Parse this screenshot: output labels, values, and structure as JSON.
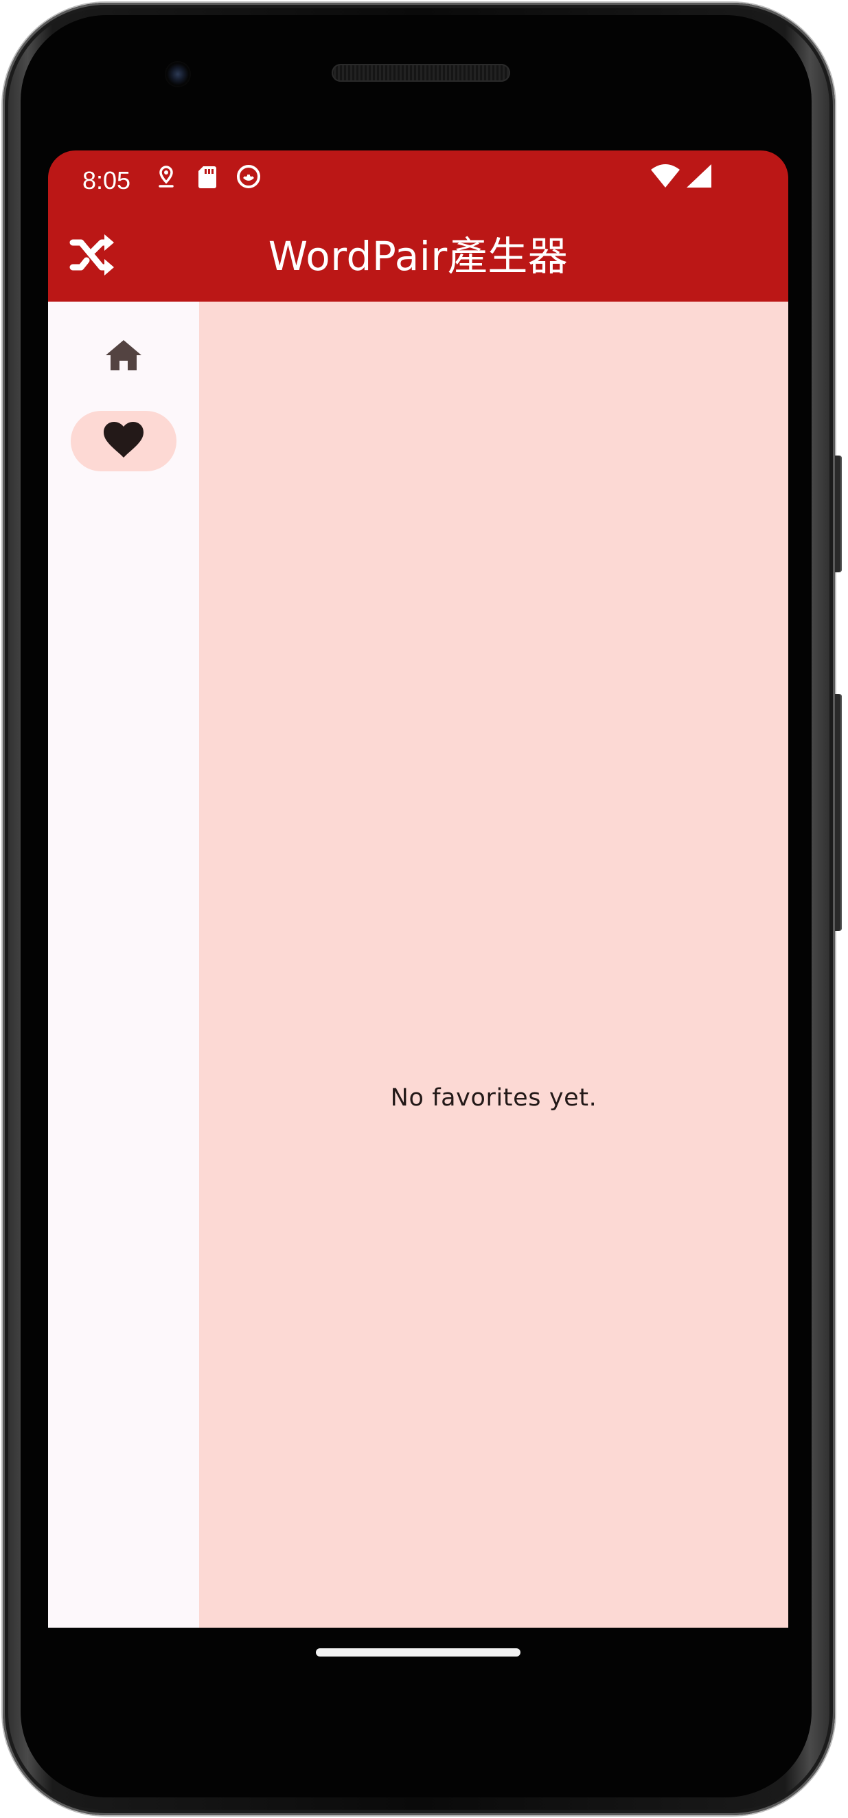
{
  "status_bar": {
    "time": "8:05",
    "icons": [
      "location-pin-icon",
      "sd-card-icon",
      "app-notification-icon",
      "wifi-icon",
      "cell-signal-icon"
    ]
  },
  "app_bar": {
    "title": "WordPair產生器",
    "action_icon": "shuffle-icon",
    "color": "#bb1716"
  },
  "nav_rail": {
    "items": [
      {
        "icon": "home-icon",
        "selected": false
      },
      {
        "icon": "heart-icon",
        "selected": true
      }
    ],
    "selected_indicator_color": "#fdd9d4"
  },
  "main": {
    "empty_message": "No favorites yet.",
    "background": "#fcd9d4"
  }
}
